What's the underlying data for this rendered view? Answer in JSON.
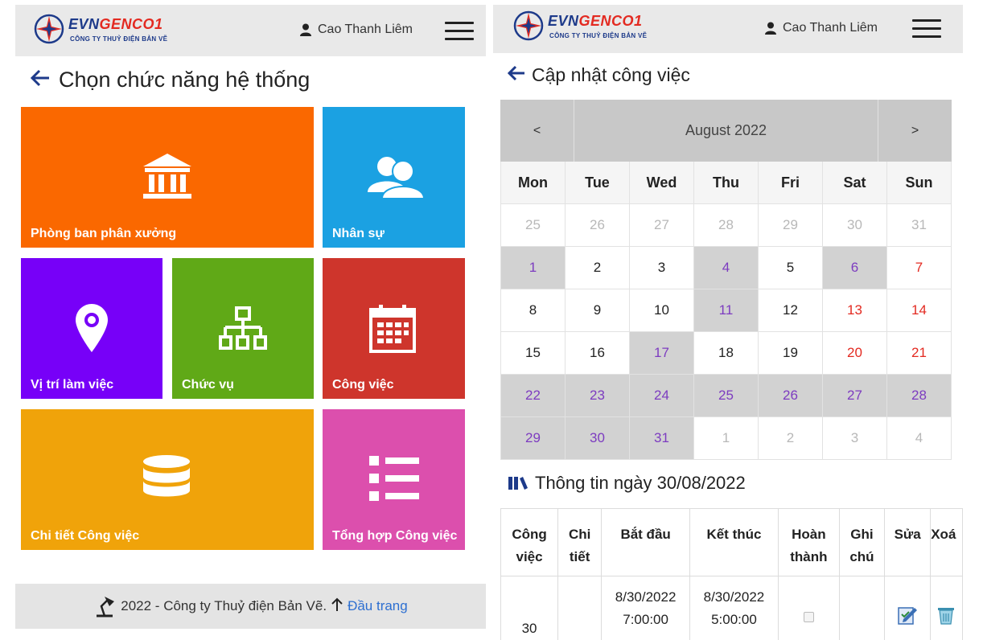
{
  "brand": {
    "evn": "EVN",
    "genco": "GENCO1",
    "subtitle": "CÔNG TY THUỶ ĐIỆN BẢN VẼ"
  },
  "user": {
    "name": "Cao Thanh Liêm"
  },
  "left": {
    "title": "Chọn chức năng hệ thống",
    "tiles": [
      {
        "label": "Phòng ban phân xưởng",
        "color": "#fa6800",
        "icon": "bank-icon"
      },
      {
        "label": "Nhân sự",
        "color": "#1ba1e2",
        "icon": "users-icon"
      },
      {
        "label": "Vị trí làm việc",
        "color": "#7700f8",
        "icon": "map-pin-icon"
      },
      {
        "label": "Chức vụ",
        "color": "#60a917",
        "icon": "org-chart-icon"
      },
      {
        "label": "Công việc",
        "color": "#ce352c",
        "icon": "calendar-icon"
      },
      {
        "label": "Chi tiết Công việc",
        "color": "#f0a30a",
        "icon": "database-icon"
      },
      {
        "label": "Tổng hợp Công việc",
        "color": "#dc4fad",
        "icon": "list-icon"
      }
    ],
    "footer": {
      "text": "2022 - Công ty Thuỷ điện Bản Vẽ.",
      "link": "Đầu trang"
    }
  },
  "right": {
    "title": "Cập nhật công việc",
    "calendar": {
      "prev": "<",
      "next": ">",
      "month": "August 2022",
      "weekdays": [
        "Mon",
        "Tue",
        "Wed",
        "Thu",
        "Fri",
        "Sat",
        "Sun"
      ],
      "weeks": [
        [
          [
            "25",
            "other"
          ],
          [
            "26",
            "other"
          ],
          [
            "27",
            "other"
          ],
          [
            "28",
            "other"
          ],
          [
            "29",
            "other"
          ],
          [
            "30",
            "other"
          ],
          [
            "31",
            "other"
          ]
        ],
        [
          [
            "1",
            "has"
          ],
          [
            "2",
            ""
          ],
          [
            "3",
            ""
          ],
          [
            "4",
            "has"
          ],
          [
            "5",
            ""
          ],
          [
            "6",
            "has"
          ],
          [
            "7",
            "weekend"
          ]
        ],
        [
          [
            "8",
            ""
          ],
          [
            "9",
            ""
          ],
          [
            "10",
            ""
          ],
          [
            "11",
            "has"
          ],
          [
            "12",
            ""
          ],
          [
            "13",
            "weekend"
          ],
          [
            "14",
            "weekend"
          ]
        ],
        [
          [
            "15",
            ""
          ],
          [
            "16",
            ""
          ],
          [
            "17",
            "has"
          ],
          [
            "18",
            ""
          ],
          [
            "19",
            ""
          ],
          [
            "20",
            "weekend"
          ],
          [
            "21",
            "weekend"
          ]
        ],
        [
          [
            "22",
            "has"
          ],
          [
            "23",
            "has"
          ],
          [
            "24",
            "has"
          ],
          [
            "25",
            "has"
          ],
          [
            "26",
            "has"
          ],
          [
            "27",
            "has"
          ],
          [
            "28",
            "has"
          ]
        ],
        [
          [
            "29",
            "has"
          ],
          [
            "30",
            "has"
          ],
          [
            "31",
            "has"
          ],
          [
            "1",
            "other"
          ],
          [
            "2",
            "other"
          ],
          [
            "3",
            "other"
          ],
          [
            "4",
            "other"
          ]
        ]
      ]
    },
    "info_title": "Thông tin ngày 30/08/2022",
    "table": {
      "headers": [
        [
          "Công",
          "việc"
        ],
        [
          "Chi",
          "tiết"
        ],
        [
          "Bắt đầu",
          ""
        ],
        [
          "Kết thúc",
          ""
        ],
        [
          "Hoàn",
          "thành"
        ],
        [
          "Ghi",
          "chú"
        ],
        [
          "Sửa",
          ""
        ],
        [
          "Xoá",
          ""
        ]
      ],
      "rows": [
        {
          "job": "30",
          "detail": "",
          "start_date": "8/30/2022",
          "start_time": "7:00:00",
          "end_date": "8/30/2022",
          "end_time": "5:00:00",
          "note": ""
        }
      ]
    }
  }
}
